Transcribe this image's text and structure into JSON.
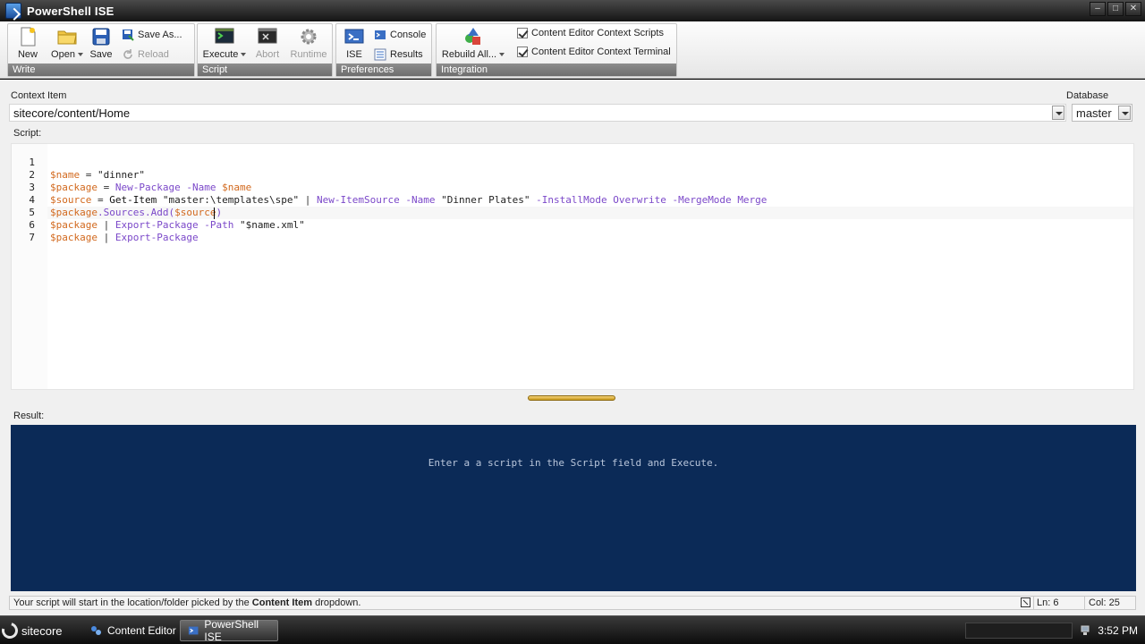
{
  "window": {
    "title": "PowerShell ISE"
  },
  "ribbon": {
    "write": {
      "label": "Write",
      "new": "New",
      "open": "Open",
      "save": "Save",
      "save_as": "Save As...",
      "reload": "Reload"
    },
    "script": {
      "label": "Script",
      "execute": "Execute",
      "abort": "Abort",
      "runtime": "Runtime"
    },
    "preferences": {
      "label": "Preferences",
      "ise": "ISE",
      "console": "Console",
      "results": "Results"
    },
    "integration": {
      "label": "Integration",
      "rebuild_all": "Rebuild All...",
      "context_scripts": "Content Editor Context Scripts",
      "context_terminal": "Content Editor Context Terminal"
    }
  },
  "context": {
    "label": "Context Item",
    "value": "sitecore/content/Home",
    "database_label": "Database",
    "database_value": "master"
  },
  "script": {
    "label": "Script:",
    "line_numbers": [
      "1",
      "2",
      "3",
      "4",
      "5",
      "6",
      "7"
    ]
  },
  "result": {
    "label": "Result:",
    "message": "Enter a a script in the Script field and Execute."
  },
  "status": {
    "message_prefix": "Your script will start in the location/folder picked by the ",
    "message_bold": "Content Item",
    "message_suffix": " dropdown.",
    "line": "Ln: 6",
    "col": "Col: 25"
  },
  "taskbar": {
    "start": "sitecore",
    "tasks": [
      "Content Editor",
      "PowerShell ISE"
    ],
    "time": "3:52 PM"
  },
  "colors": {
    "result_bg": "#0b2a57",
    "variable": "#d2691e",
    "cmdlet": "#7b48c9",
    "group_label_bg": "#7a7a7a"
  }
}
